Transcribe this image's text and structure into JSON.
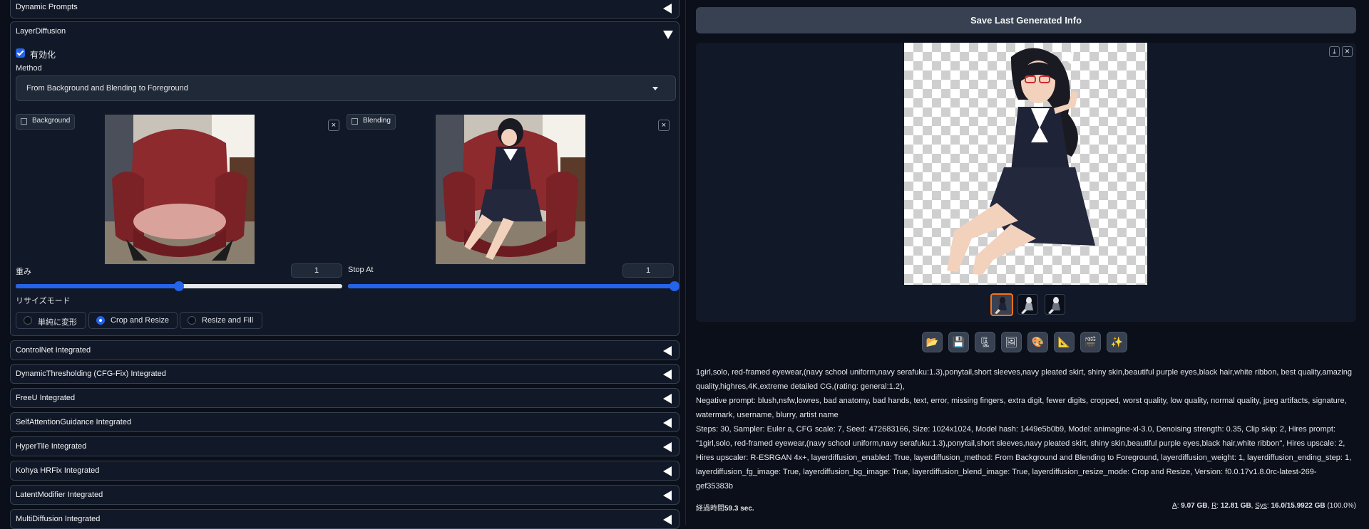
{
  "left": {
    "dynamic_prompts": "Dynamic Prompts",
    "layer_diffusion": {
      "title": "LayerDiffusion",
      "enable_label": "有効化",
      "method_label": "Method",
      "method_value": "From Background and Blending to Foreground",
      "background_label": "Background",
      "blending_label": "Blending",
      "close_glyph": "×",
      "weight_label": "重み",
      "weight_value": "1",
      "weight_fraction": 0.5,
      "stop_at_label": "Stop At",
      "stop_at_value": "1",
      "stop_at_fraction": 1.0,
      "resize_mode_label": "リサイズモード",
      "resize_options": [
        "単純に変形",
        "Crop and Resize",
        "Resize and Fill"
      ],
      "resize_selected": "Crop and Resize"
    },
    "sections": [
      "ControlNet Integrated",
      "DynamicThresholding (CFG-Fix) Integrated",
      "FreeU Integrated",
      "SelfAttentionGuidance Integrated",
      "HyperTile Integrated",
      "Kohya HRFix Integrated",
      "LatentModifier Integrated",
      "MultiDiffusion Integrated"
    ]
  },
  "right": {
    "save_button": "Save Last Generated Info",
    "download_icon": "⤓",
    "close_icon": "✕",
    "toolbar_icons": [
      "📂",
      "💾",
      "🗜",
      "🖼",
      "🎨",
      "📐",
      "🎬",
      "✨"
    ],
    "info": {
      "prompt": "1girl,solo, red-framed eyewear,(navy school uniform,navy serafuku:1.3),ponytail,short sleeves,navy pleated skirt, shiny skin,beautiful purple eyes,black hair,white ribbon, best quality,amazing quality,highres,4K,extreme detailed CG,(rating: general:1.2),",
      "negative": "Negative prompt: blush,nsfw,lowres, bad anatomy, bad hands, text, error, missing fingers, extra digit, fewer digits, cropped, worst quality, low quality, normal quality, jpeg artifacts, signature, watermark, username, blurry, artist name",
      "params": "Steps: 30, Sampler: Euler a, CFG scale: 7, Seed: 472683166, Size: 1024x1024, Model hash: 1449e5b0b9, Model: animagine-xl-3.0, Denoising strength: 0.35, Clip skip: 2, Hires prompt: \"1girl,solo, red-framed eyewear,(navy school uniform,navy serafuku:1.3),ponytail,short sleeves,navy pleated skirt, shiny skin,beautiful purple eyes,black hair,white ribbon\", Hires upscale: 2, Hires upscaler: R-ESRGAN 4x+, layerdiffusion_enabled: True, layerdiffusion_method: From Background and Blending to Foreground, layerdiffusion_weight: 1, layerdiffusion_ending_step: 1, layerdiffusion_fg_image: True, layerdiffusion_bg_image: True, layerdiffusion_blend_image: True, layerdiffusion_resize_mode: Crop and Resize, Version: f0.0.17v1.8.0rc-latest-269-gef35383b"
    },
    "status": {
      "time_label": "経過時間",
      "time_value": "59.3 sec.",
      "a_label": "A",
      "a_value": "9.07 GB",
      "r_label": "R",
      "r_value": "12.81 GB",
      "sys_label": "Sys",
      "sys_value": "16.0/15.9922 GB",
      "sys_pct": "(100.0%)"
    }
  },
  "colors": {
    "accent": "#2563eb",
    "thumb_selected": "#f97316",
    "bg": "#0b0f19"
  }
}
